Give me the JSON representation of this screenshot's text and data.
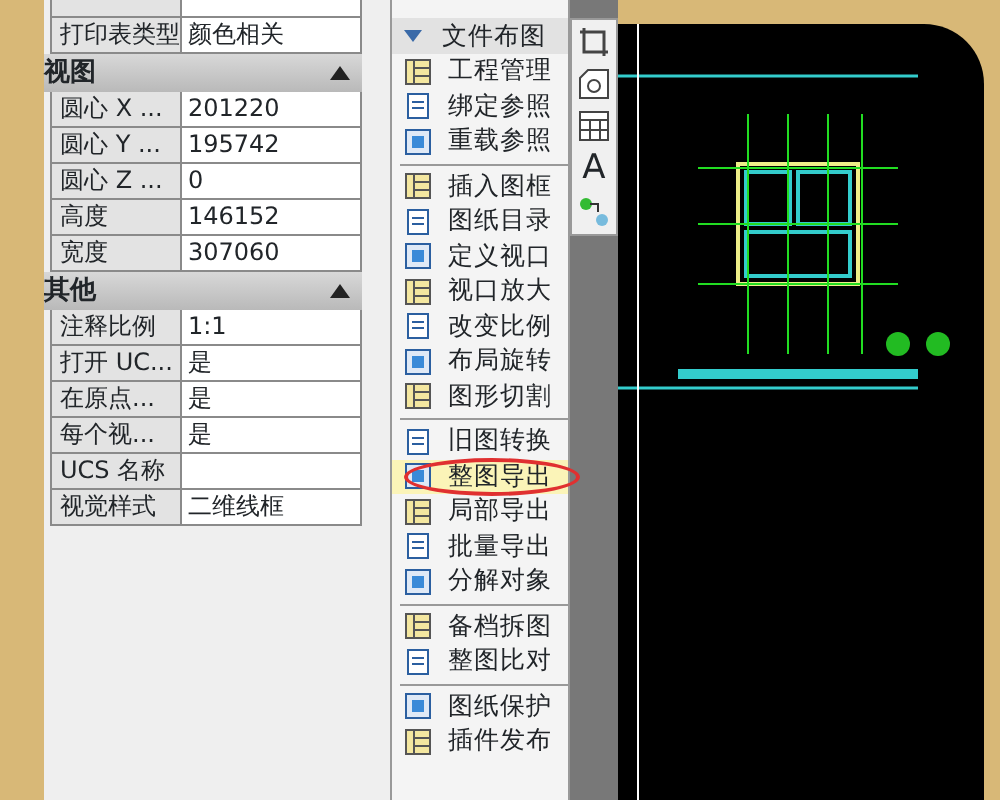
{
  "properties": {
    "sections": [
      {
        "rows": [
          {
            "label": "打印表类型",
            "value": "颜色相关"
          }
        ]
      },
      {
        "title": "视图",
        "expanded": true,
        "rows": [
          {
            "label": "圆心 X ...",
            "value": "201220"
          },
          {
            "label": "圆心 Y ...",
            "value": "195742"
          },
          {
            "label": "圆心 Z ...",
            "value": "0"
          },
          {
            "label": "高度",
            "value": "146152"
          },
          {
            "label": "宽度",
            "value": "307060"
          }
        ]
      },
      {
        "title": "其他",
        "expanded": true,
        "rows": [
          {
            "label": "注释比例",
            "value": "1:1"
          },
          {
            "label": "打开 UC...",
            "value": "是"
          },
          {
            "label": "在原点...",
            "value": "是"
          },
          {
            "label": "每个视...",
            "value": "是"
          },
          {
            "label": "UCS 名称"
          },
          {
            "label": "视觉样式",
            "value": "二维线框"
          }
        ]
      }
    ]
  },
  "menu": {
    "title": "文件布图",
    "expanded": true,
    "groups": [
      [
        {
          "label": "工程管理",
          "selected": false
        },
        {
          "label": "绑定参照",
          "selected": false
        },
        {
          "label": "重载参照",
          "selected": false
        }
      ],
      [
        {
          "label": "插入图框",
          "selected": false
        },
        {
          "label": "图纸目录",
          "selected": false
        },
        {
          "label": "定义视口",
          "selected": false
        },
        {
          "label": "视口放大",
          "selected": false
        },
        {
          "label": "改变比例",
          "selected": false
        },
        {
          "label": "布局旋转",
          "selected": false
        },
        {
          "label": "图形切割",
          "selected": false
        }
      ],
      [
        {
          "label": "旧图转换",
          "selected": false
        },
        {
          "label": "整图导出",
          "selected": true
        },
        {
          "label": "局部导出",
          "selected": false
        },
        {
          "label": "批量导出",
          "selected": false
        },
        {
          "label": "分解对象",
          "selected": false
        }
      ],
      [
        {
          "label": "备档拆图",
          "selected": false
        },
        {
          "label": "整图比对",
          "selected": false
        }
      ],
      [
        {
          "label": "图纸保护",
          "selected": false
        },
        {
          "label": "插件发布",
          "selected": false
        }
      ]
    ]
  },
  "toolbar": [
    {
      "kind": "crop"
    },
    {
      "kind": "shape"
    },
    {
      "kind": "table"
    },
    {
      "kind": "text",
      "label": "A"
    },
    {
      "kind": "link"
    }
  ]
}
